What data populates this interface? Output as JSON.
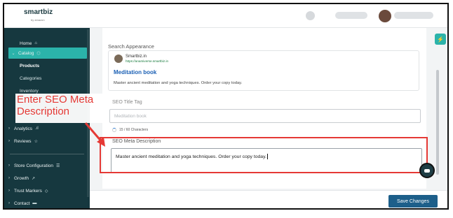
{
  "app": {
    "logo": "smartbiz",
    "logo_sub": "by amazon"
  },
  "sidebar": {
    "items": [
      {
        "label": "Home",
        "icon": "home-icon",
        "glyph": "⌂"
      },
      {
        "label": "Catalog",
        "icon": "box-icon",
        "glyph": "⬡",
        "expanded": true
      },
      {
        "label": "Products"
      },
      {
        "label": "Categories"
      },
      {
        "label": "Inventory"
      },
      {
        "label": "Analytics",
        "icon": "bar-chart-icon",
        "glyph": ".ıl"
      },
      {
        "label": "Reviews",
        "icon": "star-icon",
        "glyph": "☆"
      },
      {
        "label": "Store Configuration",
        "icon": "list-icon",
        "glyph": "☰"
      },
      {
        "label": "Growth",
        "icon": "trend-icon",
        "glyph": "↗"
      },
      {
        "label": "Trust Markers",
        "icon": "diamond-icon",
        "glyph": "◇"
      },
      {
        "label": "Contact",
        "icon": "chat-icon",
        "glyph": "▬"
      }
    ]
  },
  "seo": {
    "section_title": "Search Appearance",
    "preview": {
      "site": "Smartbiz.in",
      "url": "https://anamiverse.smartbiz.in",
      "title": "Meditation book",
      "description": "Master ancient meditation and yoga techniques. Order your copy today."
    },
    "title_tag_label": "SEO Title Tag",
    "title_tag_value": "Meditation book",
    "title_counter": "15 / 60 Characters",
    "meta_label": "SEO Meta Description",
    "meta_value": "Master ancient meditation and yoga techniques. Order your copy today."
  },
  "annotation": {
    "text": "Enter SEO Meta Description",
    "color": "#e53935"
  },
  "actions": {
    "save_label": "Save Changes"
  },
  "colors": {
    "sidebar_bg": "#16383f",
    "accent": "#2bb3aa",
    "primary_button": "#1d5f8a",
    "link": "#1a5fb4"
  }
}
